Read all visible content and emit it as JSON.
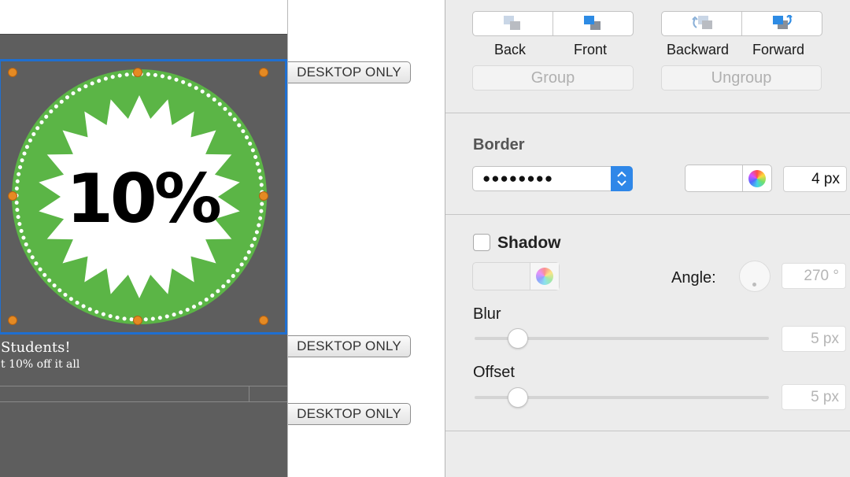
{
  "canvas": {
    "badge_text": "10%",
    "caption_line1": "Students!",
    "caption_line2": "t 10% off it all",
    "badge_color": "#5bb546",
    "selection_color": "#1f6fd0",
    "handle_color": "#e58a23"
  },
  "tags": {
    "desktop_only_1": "DESKTOP ONLY",
    "desktop_only_2": "DESKTOP ONLY",
    "desktop_only_3": "DESKTOP ONLY"
  },
  "arrange": {
    "back_label": "Back",
    "front_label": "Front",
    "backward_label": "Backward",
    "forward_label": "Forward",
    "group_label": "Group",
    "ungroup_label": "Ungroup"
  },
  "border": {
    "title": "Border",
    "style_value": "●●●●●●●●",
    "width_value": "4 px",
    "color": "#ffffff"
  },
  "shadow": {
    "title": "Shadow",
    "checked": false,
    "angle_label": "Angle:",
    "angle_value": "270 °",
    "blur_label": "Blur",
    "blur_value": "5 px",
    "offset_label": "Offset",
    "offset_value": "5 px"
  }
}
